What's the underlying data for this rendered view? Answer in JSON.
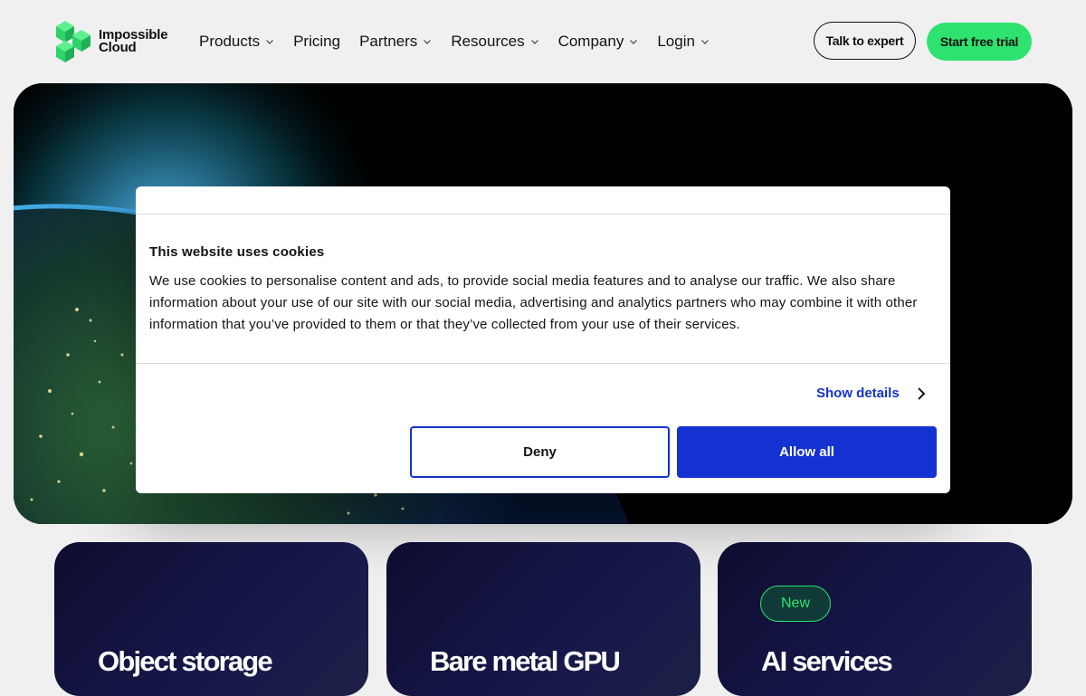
{
  "brand": {
    "name_line1": "Impossible",
    "name_line2": "Cloud",
    "accent_color": "#2ee26f"
  },
  "nav": {
    "items": [
      {
        "label": "Products",
        "has_dropdown": true
      },
      {
        "label": "Pricing",
        "has_dropdown": false
      },
      {
        "label": "Partners",
        "has_dropdown": true
      },
      {
        "label": "Resources",
        "has_dropdown": true
      },
      {
        "label": "Company",
        "has_dropdown": true
      },
      {
        "label": "Login",
        "has_dropdown": true
      }
    ],
    "talk_label": "Talk to expert",
    "trial_label": "Start free trial"
  },
  "cookie": {
    "title": "This website uses cookies",
    "body": "We use cookies to personalise content and ads, to provide social media features and to analyse our traffic. We also share information about your use of our site with our social media, advertising and analytics partners who may combine it with other information that you’ve provided to them or that they’ve collected from your use of their services.",
    "show_details": "Show details",
    "deny": "Deny",
    "allow_all": "Allow all",
    "primary_color": "#1432d2"
  },
  "cards": [
    {
      "title": "Object storage",
      "badge": ""
    },
    {
      "title": "Bare metal GPU",
      "badge": ""
    },
    {
      "title": "AI services",
      "badge": "New"
    }
  ]
}
